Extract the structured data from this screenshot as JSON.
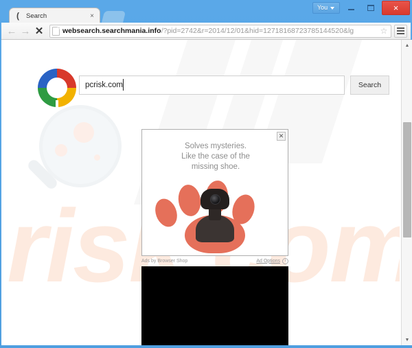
{
  "window": {
    "account_button": "You",
    "minimize_label": "Minimize",
    "maximize_label": "Maximize",
    "close_label": "×",
    "close_color": "#d93a2e",
    "chrome_color": "#4f9fe0"
  },
  "tab": {
    "favicon": "paren-favicon",
    "title": "Search",
    "close": "×",
    "new_tab_label": "New tab"
  },
  "toolbar": {
    "back": "←",
    "forward": "→",
    "stop": "✕",
    "url_host": "websearch.searchmania.info",
    "url_path": "/?pid=2742&r=2014/12/01&hid=12718168723785144520&lg",
    "url_full": "websearch.searchmania.info/?pid=2742&r=2014/12/01&hid=12718168723785144520&lg",
    "bookmark_star": "☆",
    "menu_label": "Menu"
  },
  "search": {
    "logo_name": "searchmania-ring-logo",
    "logo_colors": [
      "#d8392b",
      "#f2b200",
      "#2e9b42",
      "#2a63c4"
    ],
    "query": "pcrisk.com",
    "placeholder": "",
    "button_label": "Search"
  },
  "ad": {
    "close": "✕",
    "line1": "Solves mysteries.",
    "line2": "Like the case of the",
    "line3": "missing shoe.",
    "art_name": "paw-print-with-camera",
    "paw_color": "#e5705a",
    "camera_color": "#241f1e",
    "attribution": "Ads by Browser Shop",
    "options_label": "Ad Options",
    "info_glyph": "i"
  },
  "watermark": {
    "brand_text": "risk.com",
    "brand_color": "#fdeadf",
    "glass_name": "magnifying-glass-watermark"
  },
  "scrollbar": {
    "up": "▲",
    "down": "▼"
  }
}
